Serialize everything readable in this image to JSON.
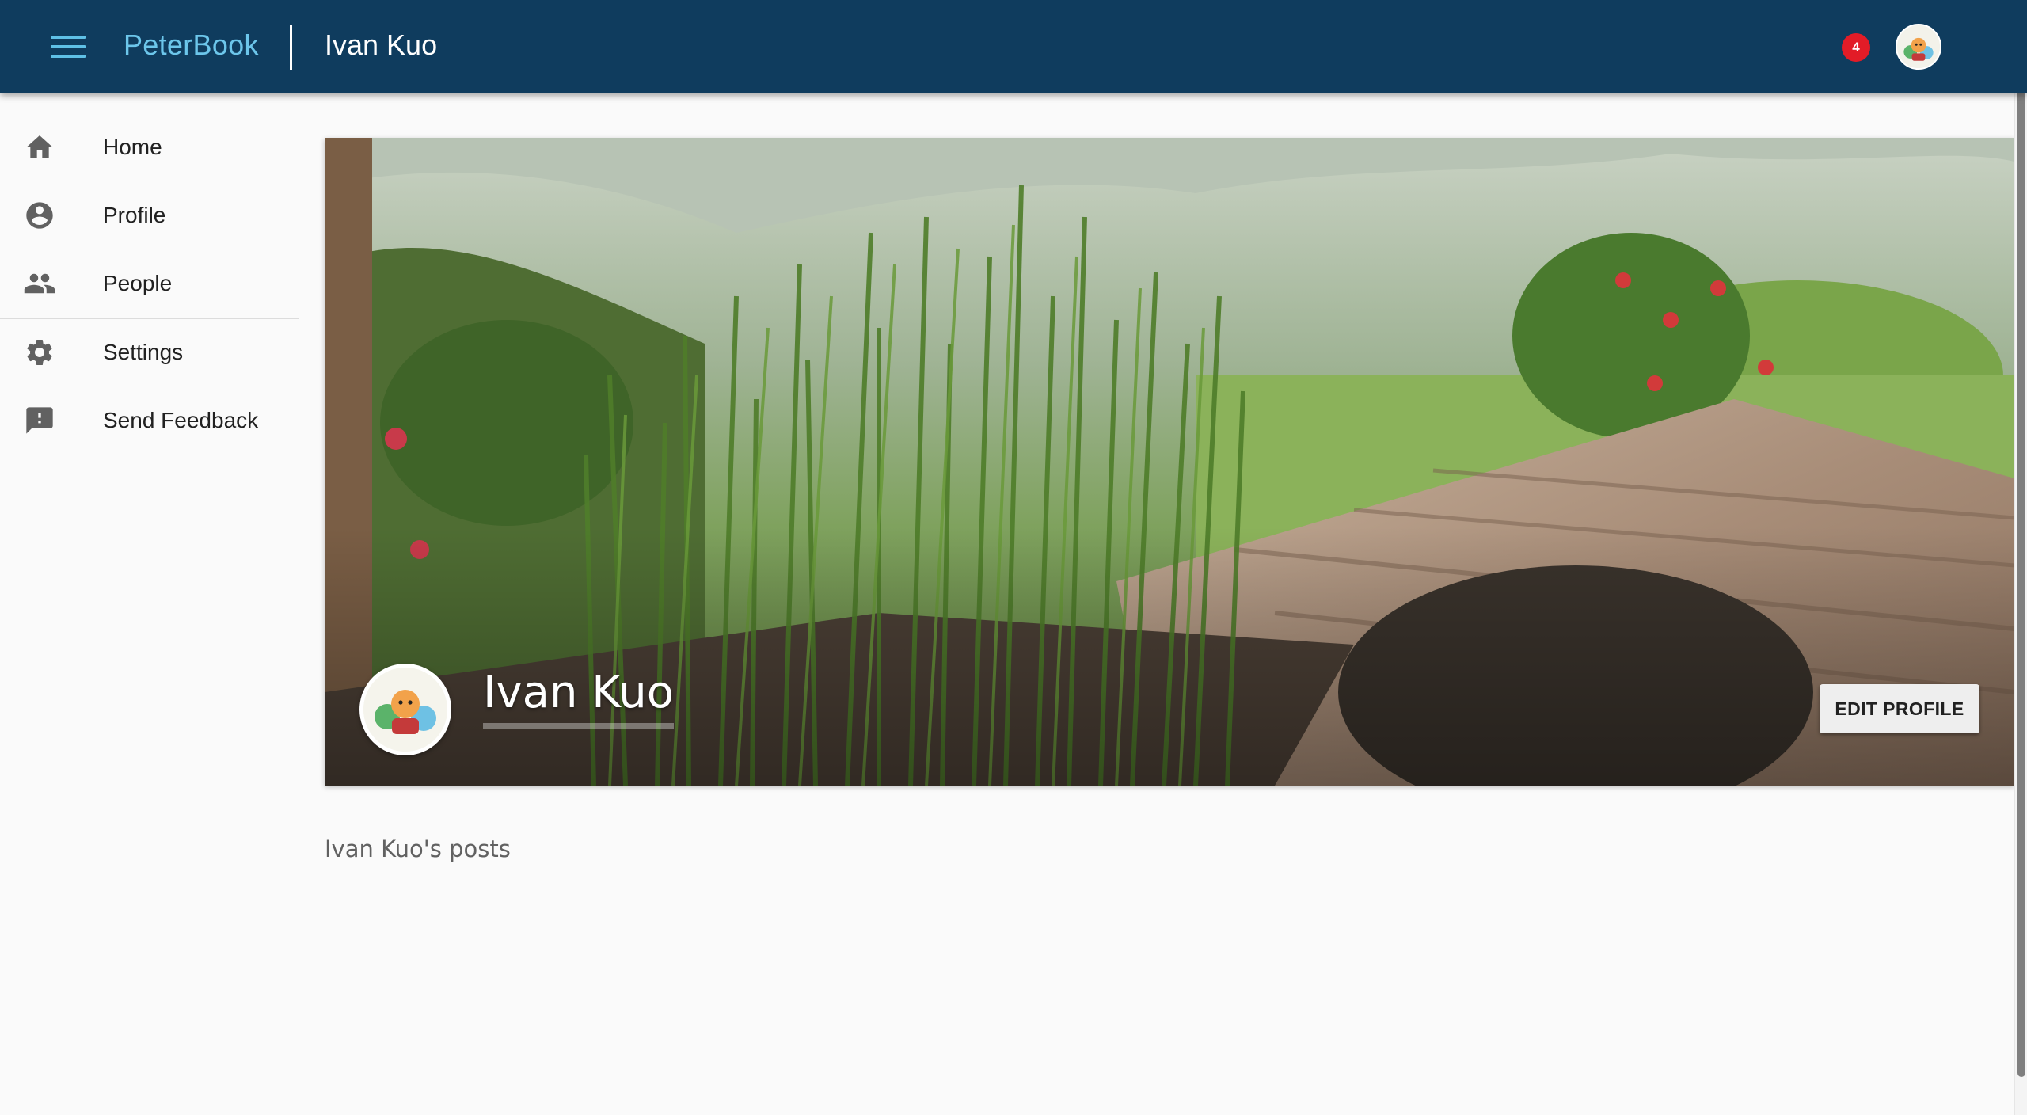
{
  "app": {
    "brand": "PeterBook",
    "page_title": "Ivan Kuo",
    "notification_count": "4"
  },
  "sidebar": {
    "items": [
      {
        "label": "Home",
        "icon": "home-icon"
      },
      {
        "label": "Profile",
        "icon": "account-circle-icon"
      },
      {
        "label": "People",
        "icon": "people-icon"
      },
      {
        "label": "Settings",
        "icon": "gear-icon"
      },
      {
        "label": "Send Feedback",
        "icon": "feedback-icon"
      }
    ]
  },
  "profile": {
    "name": "Ivan Kuo",
    "edit_button": "EDIT PROFILE",
    "cover_image": "grass-on-wooden-table-photo"
  },
  "posts": {
    "heading": "Ivan Kuo's posts"
  },
  "colors": {
    "appbar": "#0f3c5e",
    "brand": "#6cc6eb",
    "badge": "#e21c27",
    "background": "#fafafa"
  }
}
